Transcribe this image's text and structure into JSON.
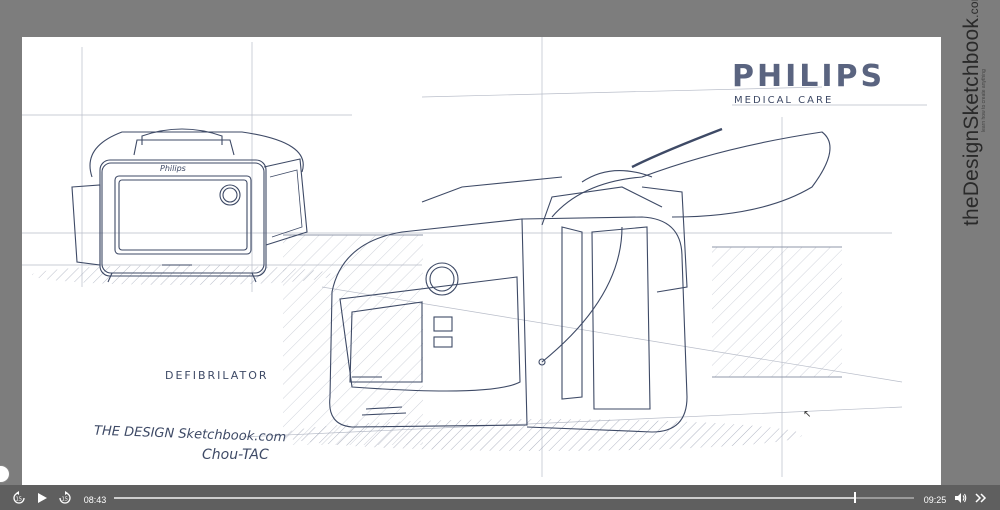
{
  "sketch": {
    "logo_text": "PHILIPS",
    "logo_subtitle": "MEDICAL CARE",
    "product_label": "DEFIBRILATOR",
    "device_brand_small": "Philips",
    "signature_site": "THE DESIGN Sketchbook.com",
    "signature_author": "Chou-TAC"
  },
  "watermark": {
    "brand": "theDesignSketchbook",
    "brand_suffix": ".com",
    "tagline": "learn how to create anything"
  },
  "player": {
    "current_time": "08:43",
    "duration": "09:25",
    "progress": 0.926,
    "icons": {
      "rewind": "rewind-15-icon",
      "play": "play-icon",
      "forward": "forward-15-icon",
      "volume": "volume-icon",
      "speed": "speed-icon"
    },
    "rewind_label": "15",
    "forward_label": "15"
  },
  "colors": {
    "background": "#7d7d7d",
    "canvas": "#ffffff",
    "ink": "#3e4a66",
    "controls_bar": "#5f5f5f"
  }
}
